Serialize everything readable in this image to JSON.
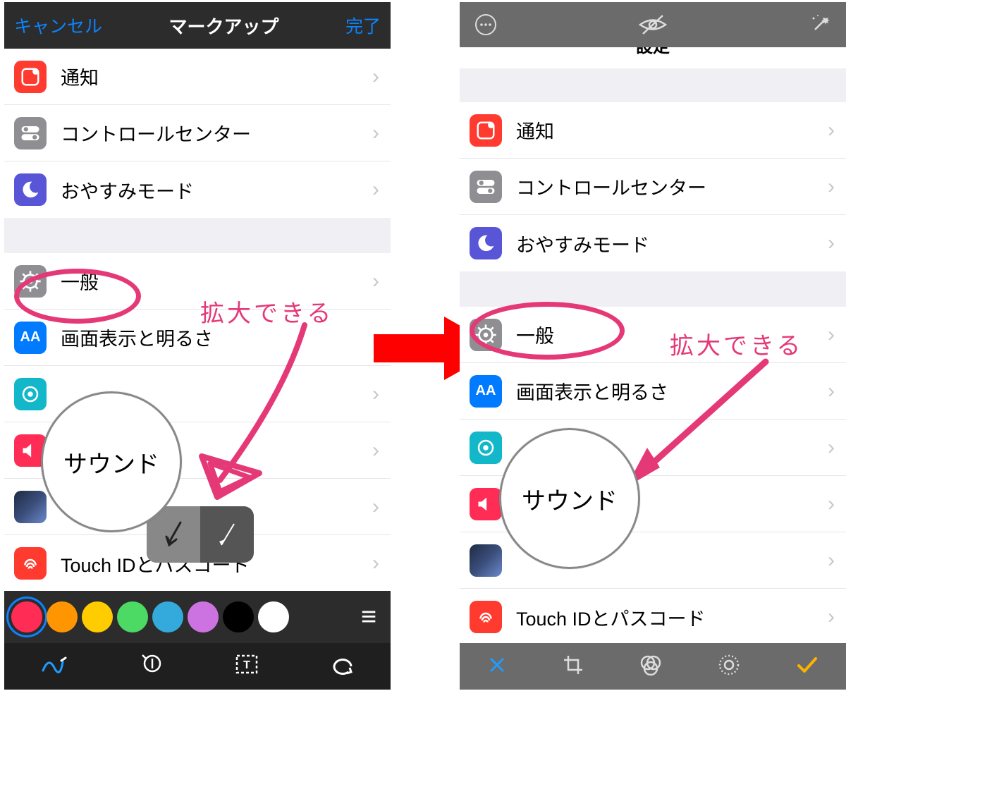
{
  "left": {
    "header": {
      "cancel": "キャンセル",
      "title": "マークアップ",
      "done": "完了"
    },
    "rows_group1": [
      {
        "label": "通知"
      },
      {
        "label": "コントロールセンター"
      },
      {
        "label": "おやすみモード"
      }
    ],
    "rows_group2": [
      {
        "label": "一般"
      },
      {
        "label": "画面表示と明るさ"
      },
      {
        "label": ""
      },
      {
        "label": ""
      },
      {
        "label": ""
      },
      {
        "label": "Touch IDとパスコード"
      }
    ],
    "annotation": {
      "text": "拡大できる",
      "magnifier_content": "サウンド"
    },
    "colors": [
      "#ff2d55",
      "#ff9500",
      "#ffcc00",
      "#4cd964",
      "#34aadc",
      "#cc73e1",
      "#000000",
      "#ffffff"
    ]
  },
  "right": {
    "title_partial": "設定",
    "rows_group1": [
      {
        "label": "通知"
      },
      {
        "label": "コントロールセンター"
      },
      {
        "label": "おやすみモード"
      }
    ],
    "rows_group2": [
      {
        "label": "一般"
      },
      {
        "label": "画面表示と明るさ"
      },
      {
        "label": ""
      },
      {
        "label": ""
      },
      {
        "label": ""
      },
      {
        "label": "Touch IDとパスコード"
      }
    ],
    "annotation": {
      "text": "拡大できる",
      "magnifier_content": "サウンド"
    }
  }
}
